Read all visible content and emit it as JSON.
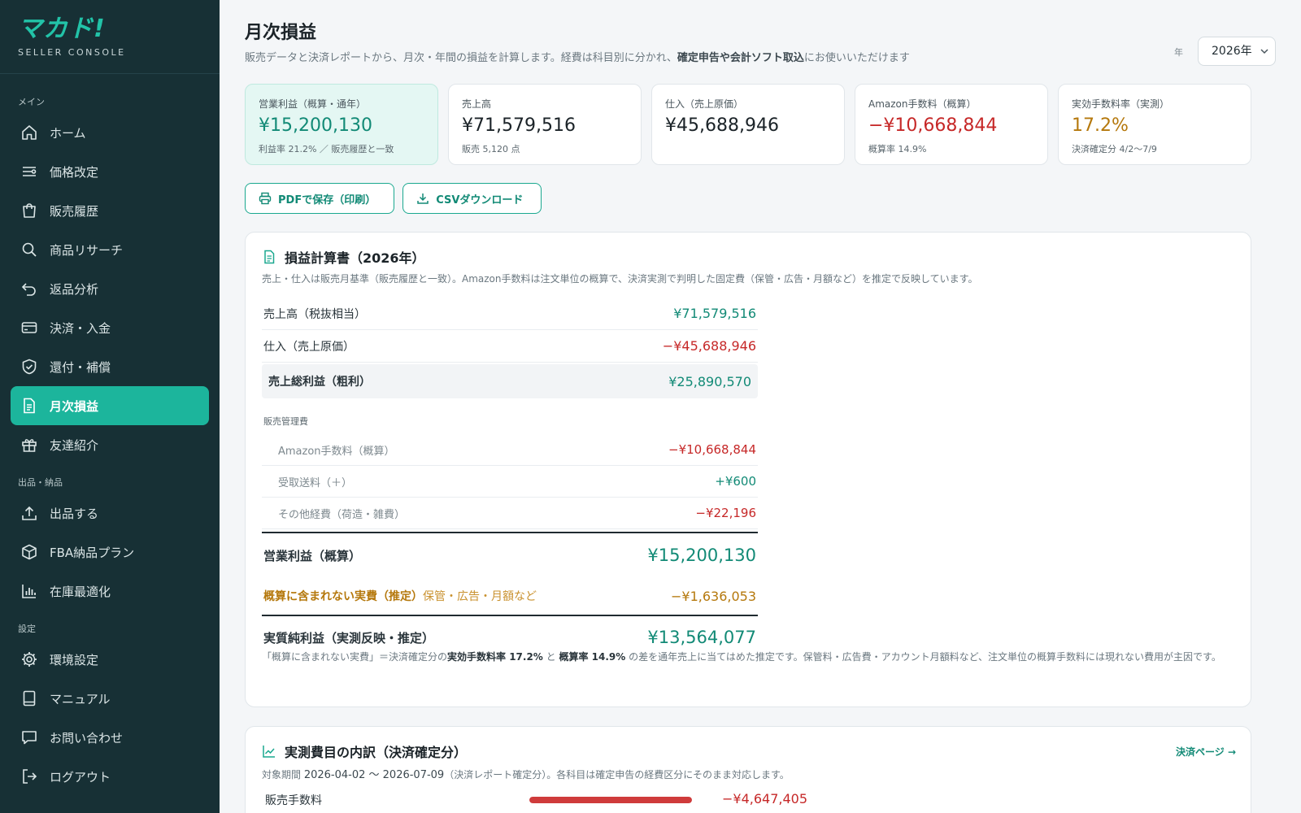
{
  "app": {
    "logo": "マカド!",
    "logo_sub": "SELLER CONSOLE"
  },
  "sidebar": {
    "sections": [
      {
        "title": "メイン",
        "items": [
          {
            "label": "ホーム",
            "icon": "home-icon"
          },
          {
            "label": "価格改定",
            "icon": "sliders-icon"
          },
          {
            "label": "販売履歴",
            "icon": "shopping-bag-icon"
          },
          {
            "label": "商品リサーチ",
            "icon": "search-icon"
          },
          {
            "label": "返品分析",
            "icon": "undo-icon"
          },
          {
            "label": "決済・入金",
            "icon": "credit-card-icon"
          },
          {
            "label": "還付・補償",
            "icon": "shield-check-icon"
          },
          {
            "label": "月次損益",
            "icon": "document-icon",
            "active": true
          },
          {
            "label": "友達紹介",
            "icon": "gift-icon"
          }
        ]
      },
      {
        "title": "出品・納品",
        "items": [
          {
            "label": "出品する",
            "icon": "upload-icon"
          },
          {
            "label": "FBA納品プラン",
            "icon": "box-icon"
          },
          {
            "label": "在庫最適化",
            "icon": "bar-chart-icon"
          }
        ]
      },
      {
        "title": "設定",
        "items": [
          {
            "label": "環境設定",
            "icon": "gear-icon"
          },
          {
            "label": "マニュアル",
            "icon": "book-icon"
          },
          {
            "label": "お問い合わせ",
            "icon": "chat-icon"
          },
          {
            "label": "ログアウト",
            "icon": "logout-icon"
          }
        ]
      }
    ]
  },
  "header": {
    "title": "月次損益",
    "desc_1": "販売データと決済レポートから、月次・年間の損益を計算します。経費は科目別に分かれ、",
    "desc_bold": "確定申告や会計ソフト取込",
    "desc_2": "にお使いいただけます",
    "year_label": "年",
    "year_value": "2026年"
  },
  "kpis": [
    {
      "label": "営業利益（概算・通年）",
      "value": "¥15,200,130",
      "sub": "利益率 21.2% ／ 販売履歴と一致",
      "tone": "pos",
      "highlight": true
    },
    {
      "label": "売上高",
      "value": "¥71,579,516",
      "sub": "販売 5,120 点",
      "tone": "",
      "highlight": false
    },
    {
      "label": "仕入（売上原価）",
      "value": "¥45,688,946",
      "sub": "",
      "tone": "",
      "highlight": false
    },
    {
      "label": "Amazon手数料（概算）",
      "value": "−¥10,668,844",
      "sub": "概算率 14.9%",
      "tone": "neg",
      "highlight": false
    },
    {
      "label": "実効手数料率（実測）",
      "value": "17.2%",
      "sub": "決済確定分 4/2〜7/9",
      "tone": "amber",
      "highlight": false
    }
  ],
  "actions": {
    "pdf": "PDFで保存（印刷）",
    "csv": "CSVダウンロード"
  },
  "pl": {
    "title": "損益計算書（2026年）",
    "note": "売上・仕入は販売月基準（販売履歴と一致）。Amazon手数料は注文単位の概算で、決済実測で判明した固定費（保管・広告・月額など）を推定で反映しています。",
    "sales_label": "売上高（税抜相当）",
    "sales_value": "¥71,579,516",
    "cogs_label": "仕入（売上原価）",
    "cogs_value": "−¥45,688,946",
    "gross_label": "売上総利益（粗利）",
    "gross_value": "¥25,890,570",
    "sga_label": "販売管理費",
    "sga_items": [
      {
        "label": "Amazon手数料（概算）",
        "value": "−¥10,668,844",
        "tone": "neg"
      },
      {
        "label": "受取送料（＋）",
        "value": "+¥600",
        "tone": "pos"
      },
      {
        "label": "その他経費（荷造・雑費）",
        "value": "−¥22,196",
        "tone": "neg"
      }
    ],
    "op_label": "営業利益（概算）",
    "op_value": "¥15,200,130",
    "est_label": "概算に含まれない実費（推定）",
    "est_hint": "保管・広告・月額など",
    "est_value": "−¥1,636,053",
    "net_label": "実質純利益（実測反映・推定）",
    "net_value": "¥13,564,077",
    "foot_1": "「概算に含まれない実費」＝決済確定分の",
    "foot_b1": "実効手数料率 17.2%",
    "foot_2": " と ",
    "foot_b2": "概算率 14.9%",
    "foot_3": " の差を通年売上に当てはめた推定です。保管料・広告費・アカウント月額料など、注文単位の概算手数料には現れない費用が主因です。"
  },
  "breakdown": {
    "title": "実測費目の内訳（決済確定分）",
    "link": "決済ページ →",
    "period_label": "対象期間",
    "period_value": "2026-04-02 〜 2026-07-09",
    "period_note": "（決済レポート確定分）。各科目は確定申告の経費区分にそのまま対応します。",
    "rows": [
      {
        "label": "販売手数料",
        "value": "−¥4,647,405",
        "share": 1.0
      }
    ]
  },
  "colors": {
    "sidebar_bg": "#173035",
    "accent": "#1cb59c",
    "positive": "#128a76",
    "negative": "#c62828",
    "amber": "#b5780c"
  }
}
